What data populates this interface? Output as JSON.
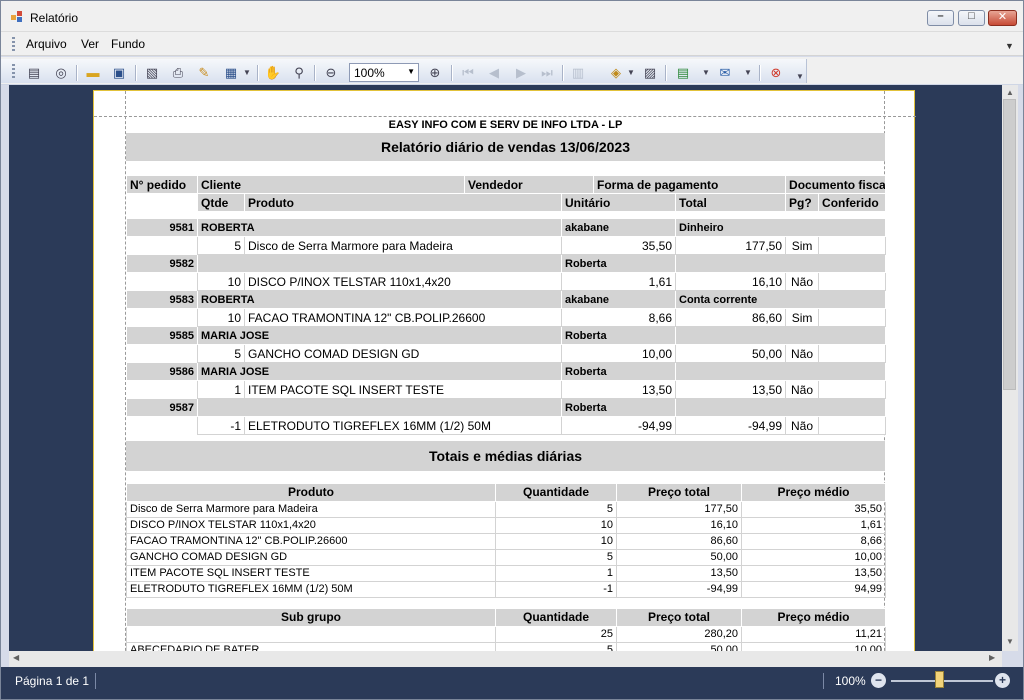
{
  "window": {
    "title": "Relatório",
    "controls": [
      "minimize-icon",
      "maximize-icon",
      "close-icon"
    ]
  },
  "menu": {
    "items": [
      "Arquivo",
      "Ver",
      "Fundo"
    ]
  },
  "toolbar": {
    "zoom": "100%",
    "icons": [
      "document-map-icon",
      "search-binoculars-icon",
      "open-folder-icon",
      "save-icon",
      "page-setup-icon",
      "print-icon",
      "print-preview-icon",
      "multiple-pages-icon",
      "hand-tool-icon",
      "magnifier-icon",
      "zoom-out-icon",
      "zoom-in-icon",
      "first-page-icon",
      "previous-page-icon",
      "next-page-icon",
      "last-page-icon",
      "multipage-layout-icon",
      "background-color-icon",
      "watermark-icon",
      "export-icon",
      "email-icon",
      "close-preview-icon"
    ]
  },
  "report": {
    "company": "EASY INFO COM E SERV DE INFO LTDA - LP",
    "title": "Relatório diário de vendas 13/06/2023",
    "headers": {
      "row1": [
        "N° pedido",
        "Cliente",
        "Vendedor",
        "Forma de pagamento",
        "Documento fiscal"
      ],
      "row2": [
        "Qtde",
        "Produto",
        "Unitário",
        "Total",
        "Pg?",
        "Conferido"
      ]
    },
    "orders": [
      {
        "id": "9581",
        "client": "ROBERTA",
        "seller": "akabane",
        "payment": "Dinheiro",
        "qty": "5",
        "product": "Disco de Serra Marmore para Madeira",
        "unit": "35,50",
        "total": "177,50",
        "paid": "Sim"
      },
      {
        "id": "9582",
        "client": "",
        "seller": "Roberta",
        "payment": "",
        "qty": "10",
        "product": "DISCO P/INOX TELSTAR 110x1,4x20",
        "unit": "1,61",
        "total": "16,10",
        "paid": "Não"
      },
      {
        "id": "9583",
        "client": "ROBERTA",
        "seller": "akabane",
        "payment": "Conta corrente",
        "qty": "10",
        "product": "FACAO TRAMONTINA 12\" CB.POLIP.26600",
        "unit": "8,66",
        "total": "86,60",
        "paid": "Sim"
      },
      {
        "id": "9585",
        "client": "MARIA JOSE",
        "seller": "Roberta",
        "payment": "",
        "qty": "5",
        "product": "GANCHO COMAD DESIGN GD",
        "unit": "10,00",
        "total": "50,00",
        "paid": "Não"
      },
      {
        "id": "9586",
        "client": "MARIA JOSE",
        "seller": "Roberta",
        "payment": "",
        "qty": "1",
        "product": "ITEM PACOTE SQL INSERT TESTE",
        "unit": "13,50",
        "total": "13,50",
        "paid": "Não"
      },
      {
        "id": "9587",
        "client": "",
        "seller": "Roberta",
        "payment": "",
        "qty": "-1",
        "product": "ELETRODUTO TIGREFLEX 16MM (1/2) 50M",
        "unit": "-94,99",
        "total": "-94,99",
        "paid": "Não"
      }
    ],
    "totals_title": "Totais e médias diárias",
    "products_table": {
      "headers": [
        "Produto",
        "Quantidade",
        "Preço total",
        "Preço médio"
      ],
      "rows": [
        [
          "Disco de Serra Marmore para Madeira",
          "5",
          "177,50",
          "35,50"
        ],
        [
          "DISCO P/INOX TELSTAR 110x1,4x20",
          "10",
          "16,10",
          "1,61"
        ],
        [
          "FACAO TRAMONTINA 12\" CB.POLIP.26600",
          "10",
          "86,60",
          "8,66"
        ],
        [
          "GANCHO COMAD DESIGN GD",
          "5",
          "50,00",
          "10,00"
        ],
        [
          "ITEM PACOTE SQL INSERT TESTE",
          "1",
          "13,50",
          "13,50"
        ],
        [
          "ELETRODUTO TIGREFLEX 16MM (1/2) 50M",
          "-1",
          "-94,99",
          "94,99"
        ]
      ]
    },
    "subgroup_table": {
      "headers": [
        "Sub grupo",
        "Quantidade",
        "Preço total",
        "Preço médio"
      ],
      "rows": [
        [
          "",
          "25",
          "280,20",
          "11,21"
        ],
        [
          "ABECEDARIO DE BATER",
          "5",
          "50,00",
          "10,00"
        ]
      ]
    }
  },
  "status": {
    "page": "Página 1 de 1",
    "zoom": "100%"
  }
}
